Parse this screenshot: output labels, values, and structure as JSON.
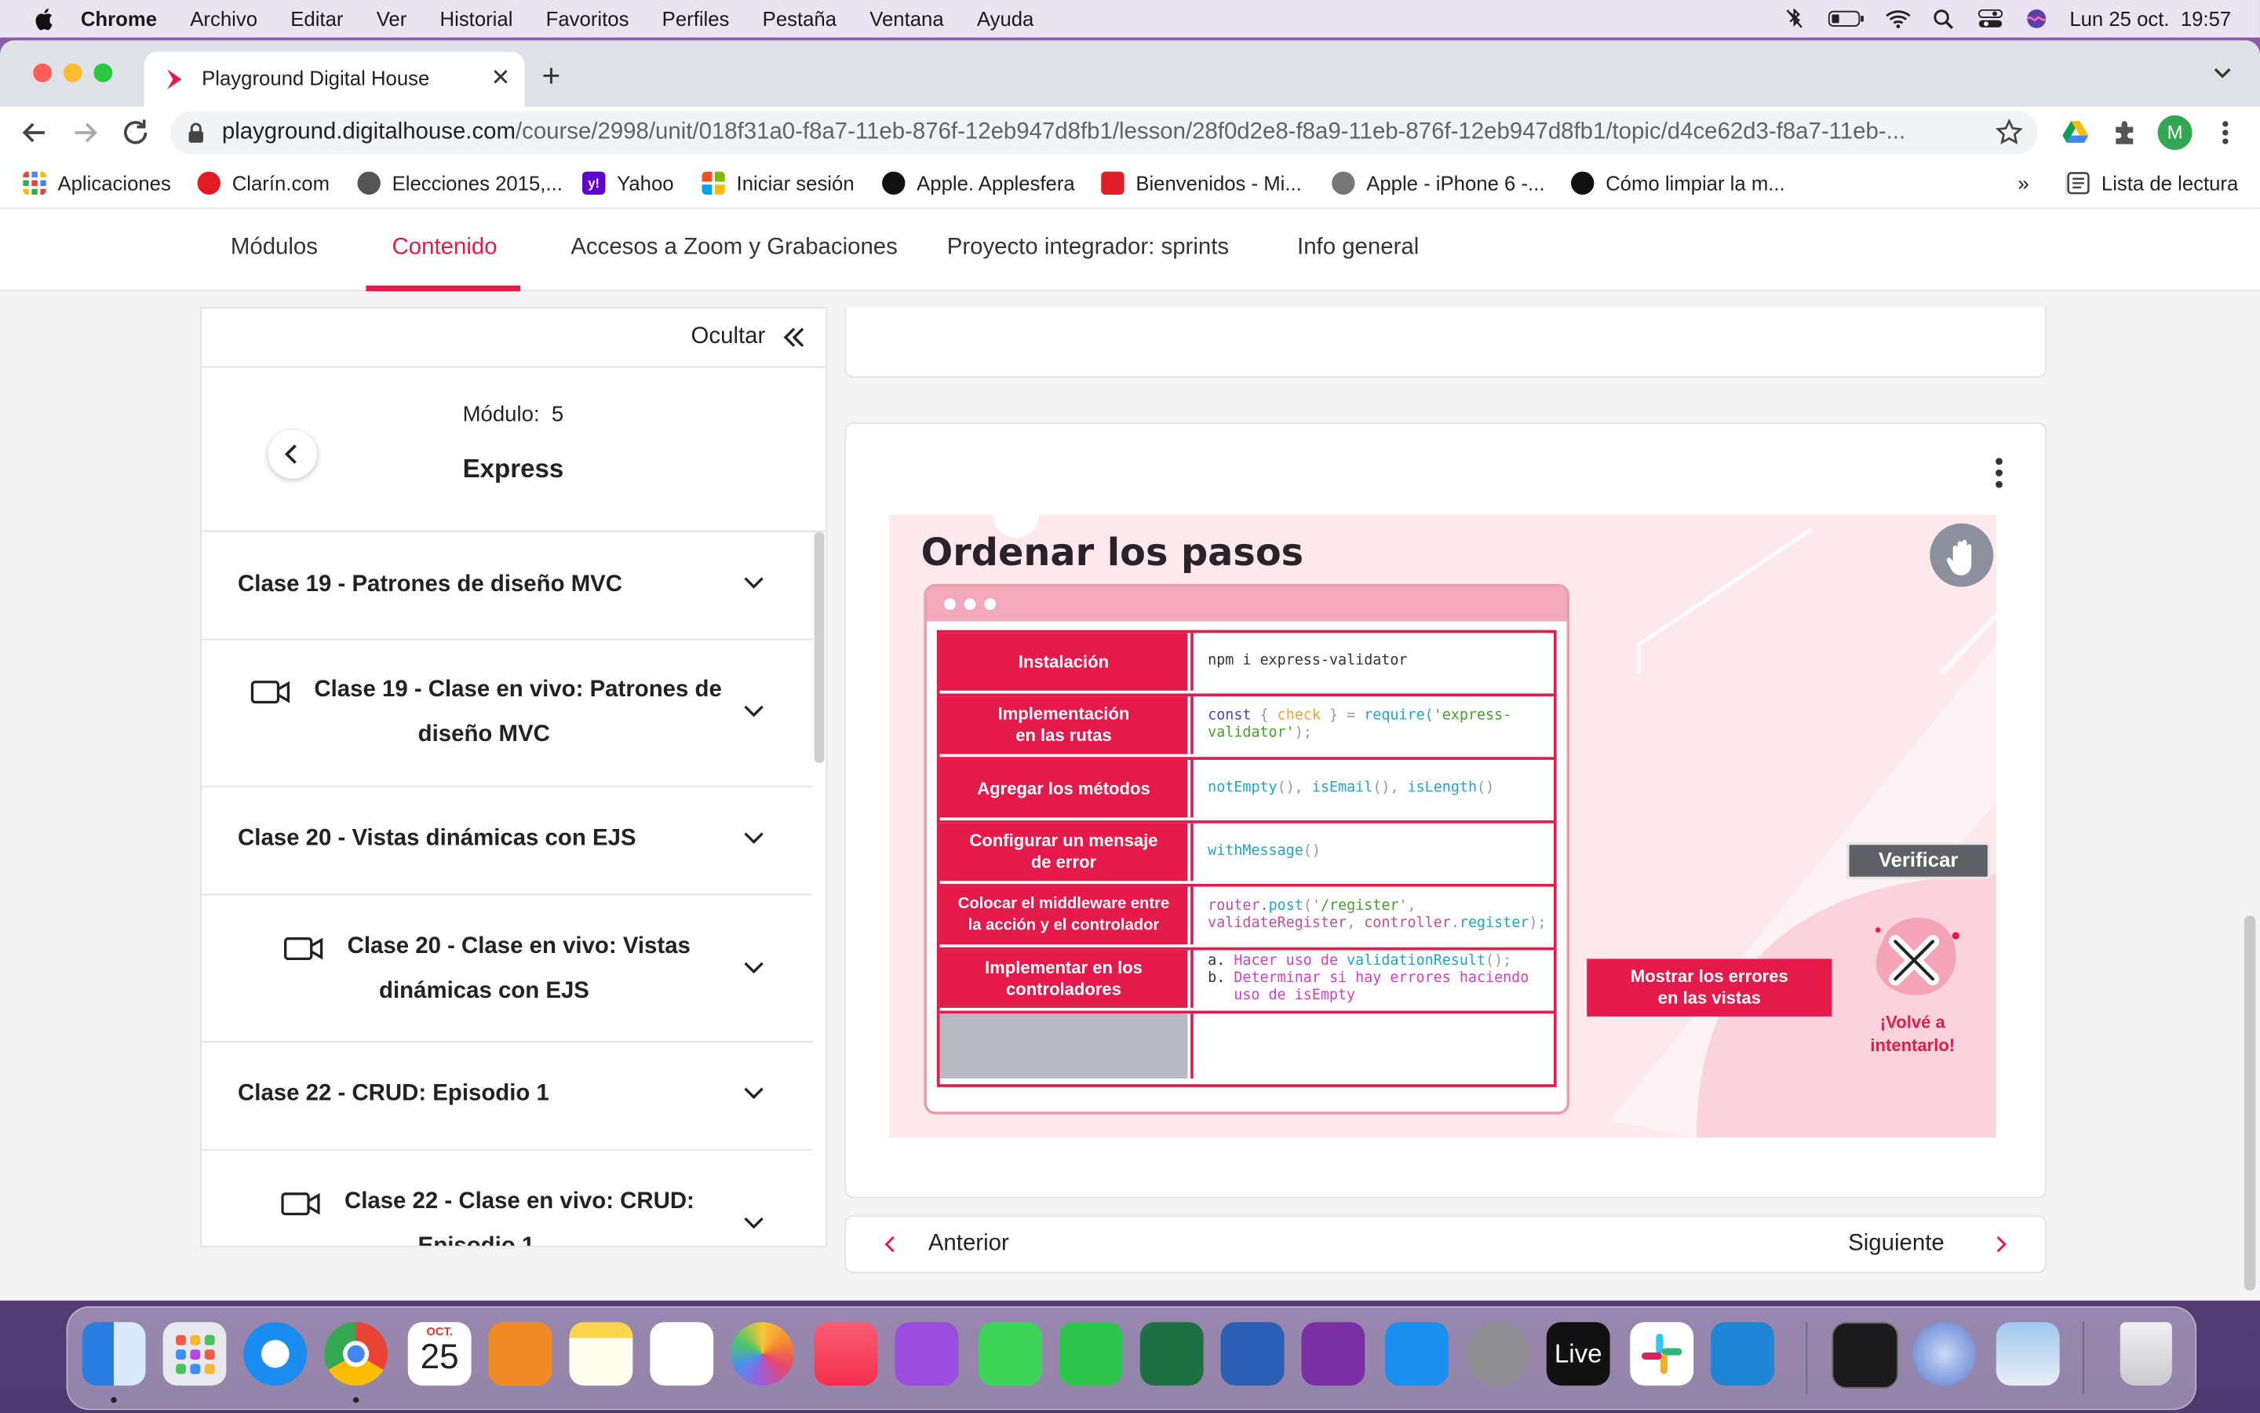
{
  "menubar": {
    "app": "Chrome",
    "items": [
      "Archivo",
      "Editar",
      "Ver",
      "Historial",
      "Favoritos",
      "Perfiles",
      "Pestaña",
      "Ventana",
      "Ayuda"
    ],
    "datetime": "Lun 25 oct.  19:57"
  },
  "browser": {
    "tab_title": "Playground Digital House",
    "url_host": "playground.digitalhouse.com",
    "url_path": "/course/2998/unit/018f31a0-f8a7-11eb-876f-12eb947d8fb1/lesson/28f0d2e8-f8a9-11eb-876f-12eb947d8fb1/topic/d4ce62d3-f8a7-11eb-...",
    "profile_initial": "M",
    "bookmarks": [
      "Aplicaciones",
      "Clarín.com",
      "Elecciones 2015,...",
      "Yahoo",
      "Iniciar sesión",
      "Apple. Applesfera",
      "Bienvenidos - Mi...",
      "Apple - iPhone 6 -...",
      "Cómo limpiar la m..."
    ],
    "bookmarks_overflow": "»",
    "reading_list": "Lista de lectura"
  },
  "topnav": {
    "items": [
      "Módulos",
      "Contenido",
      "Accesos a Zoom y Grabaciones",
      "Proyecto integrador: sprints",
      "Info general"
    ],
    "active": "Contenido"
  },
  "sidebar": {
    "hide_label": "Ocultar",
    "module_label": "Módulo:  5",
    "module_name": "Express",
    "items": [
      {
        "label": "Clase 19 - Patrones de diseño MVC",
        "video": false
      },
      {
        "label_line1": "Clase 19 - Clase en vivo: Patrones de",
        "label_line2": "diseño MVC",
        "video": true
      },
      {
        "label": "Clase 20 - Vistas dinámicas con EJS",
        "video": false
      },
      {
        "label_line1": "Clase 20 - Clase en vivo: Vistas",
        "label_line2": "dinámicas con EJS",
        "video": true
      },
      {
        "label": "Clase 22 - CRUD: Episodio 1",
        "video": false
      },
      {
        "label_line1": "Clase 22 - Clase en vivo: CRUD:",
        "label_line2": "Episodio 1",
        "video": true
      }
    ]
  },
  "activity": {
    "title": "Ordenar los pasos",
    "rows": [
      {
        "step": "Instalación",
        "code": "npm i express-validator"
      },
      {
        "step_line1": "Implementación",
        "step_line2": "en las rutas",
        "code_parts": [
          "const",
          " { ",
          "check",
          " } = ",
          "require(",
          "'express-",
          "validator'",
          ");"
        ]
      },
      {
        "step": "Agregar los métodos",
        "code_parts": [
          "notEmpty",
          "(), ",
          "isEmail",
          "(), ",
          "isLength",
          "()"
        ]
      },
      {
        "step_line1": "Configurar un mensaje",
        "step_line2": "de error",
        "code_parts": [
          "withMessage",
          "()"
        ]
      },
      {
        "step_line1": "Colocar el middleware entre",
        "step_line2": "la acción y el controlador",
        "code_parts": [
          "router.",
          "post",
          "('",
          "/register",
          "',",
          "validateRegister",
          ", ",
          "controller",
          ".",
          "register",
          ");"
        ]
      },
      {
        "step_line1": "Implementar en los",
        "step_line2": "controladores",
        "code_parts": [
          "a. ",
          "Hacer uso de ",
          "validationResult",
          "();",
          "b. ",
          "Determinar si hay errores haciendo",
          "uso de ",
          "isEmpty"
        ]
      },
      {
        "step": "",
        "code": ""
      }
    ],
    "drag_item_line1": "Mostrar los errores",
    "drag_item_line2": "en las vistas",
    "verify_label": "Verificar",
    "retry_line1": "¡Volvé a",
    "retry_line2": "intentarlo!",
    "colors": {
      "accent": "#e41a4a",
      "background": "#fde8ee"
    }
  },
  "pager": {
    "prev": "Anterior",
    "next": "Siguiente"
  },
  "dock": {
    "calendar_month": "OCT.",
    "calendar_day": "25",
    "live_label": "Live",
    "apps": [
      "finder-icon",
      "launchpad-icon",
      "safari-icon",
      "chrome-icon",
      "calendar-icon",
      "books-icon",
      "notes-icon",
      "reminders-icon",
      "photos-icon",
      "music-icon",
      "podcasts-icon",
      "messages-icon",
      "facetime-icon",
      "excel-icon",
      "word-icon",
      "onenote-icon",
      "app-store-icon",
      "system-preferences-icon",
      "ableton-live-icon",
      "slack-icon",
      "vscode-icon",
      "terminal-icon",
      "qbittorrent-icon",
      "preview-icon",
      "trash-icon"
    ]
  }
}
